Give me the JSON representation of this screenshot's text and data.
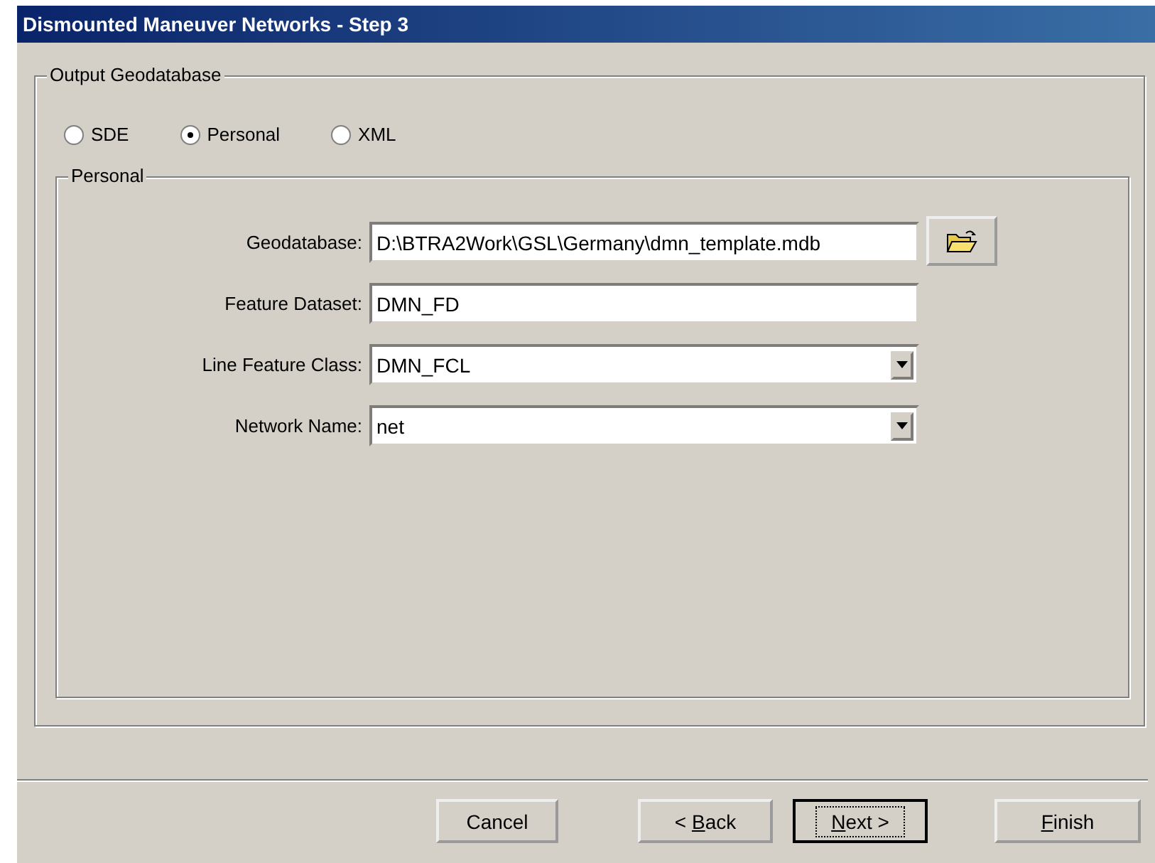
{
  "window": {
    "title": "Dismounted Maneuver Networks - Step 3"
  },
  "output_group": {
    "title": "Output Geodatabase",
    "options": [
      {
        "label": "SDE",
        "selected": false
      },
      {
        "label": "Personal",
        "selected": true
      },
      {
        "label": "XML",
        "selected": false
      }
    ]
  },
  "personal_group": {
    "title": "Personal",
    "fields": [
      {
        "kind": "text",
        "label": "Geodatabase:",
        "value": "D:\\BTRA2Work\\GSL\\Germany\\dmn_template.mdb",
        "browse": true
      },
      {
        "kind": "text",
        "label": "Feature Dataset:",
        "value": "DMN_FD",
        "browse": false
      },
      {
        "kind": "dropdown",
        "label": "Line Feature Class:",
        "value": "DMN_FCL",
        "browse": false
      },
      {
        "kind": "dropdown",
        "label": "Network Name:",
        "value": "net",
        "browse": false
      }
    ]
  },
  "buttons": [
    {
      "after": "Cancel",
      "default": false
    },
    {
      "before": "< ",
      "accel": "B",
      "after": "ack",
      "default": false
    },
    {
      "accel": "N",
      "after": "ext >",
      "default": true
    },
    {
      "accel": "F",
      "after": "inish",
      "default": false
    }
  ]
}
